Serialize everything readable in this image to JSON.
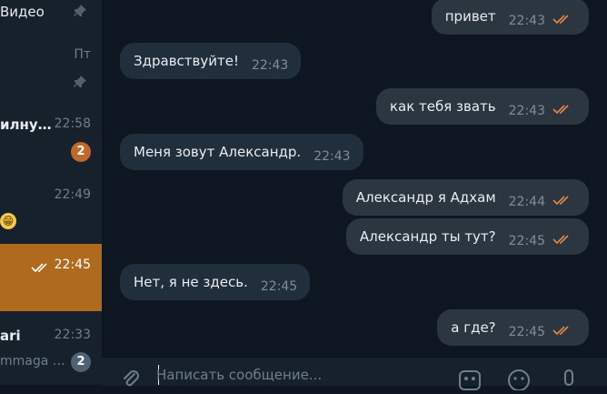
{
  "sidebar": {
    "chats": [
      {
        "name": "Видео",
        "time": "",
        "pinned": true,
        "badge": "",
        "preview": ""
      },
      {
        "name": "",
        "time": "Пт",
        "pinned": true,
        "badge": "",
        "preview": ""
      },
      {
        "name": "илну…",
        "time": "22:58",
        "pinned": false,
        "badge": "2",
        "badge_color": "#c0692b",
        "preview": ""
      },
      {
        "name": "",
        "time": "22:49",
        "pinned": false,
        "badge": "",
        "preview": "",
        "emoji": "😁"
      },
      {
        "name": "",
        "time": "22:45",
        "pinned": false,
        "badge": "",
        "preview": "",
        "active": true,
        "read_ticks": true
      },
      {
        "name": "ari",
        "time": "22:33",
        "pinned": false,
        "badge": "2",
        "badge_color": "#4f6173",
        "preview": "mmaga …"
      }
    ]
  },
  "messages": [
    {
      "direction": "out",
      "text": "привет",
      "time": "22:43",
      "read": true
    },
    {
      "direction": "in",
      "text": "Здравствуйте!",
      "time": "22:43"
    },
    {
      "direction": "out",
      "text": "как тебя звать",
      "time": "22:43",
      "read": true
    },
    {
      "direction": "in",
      "text": "Меня зовут Александр.",
      "time": "22:43"
    },
    {
      "direction": "out",
      "text": "Александр я Адхам",
      "time": "22:44",
      "read": true
    },
    {
      "direction": "out",
      "text": "Александр ты тут?",
      "time": "22:45",
      "read": true
    },
    {
      "direction": "in",
      "text": "Нет, я не здесь.",
      "time": "22:45"
    },
    {
      "direction": "out",
      "text": "а где?",
      "time": "22:45",
      "read": true
    }
  ],
  "composer": {
    "placeholder": "Написать сообщение...",
    "value": "",
    "icons": [
      "attach-icon",
      "bot-commands-icon",
      "emoji-icon",
      "microphone-icon"
    ]
  },
  "colors": {
    "chat_bg": "#0e1621",
    "sidebar_bg": "#17212b",
    "active_chat": "#b06a1e",
    "bubble_in": "#212e3b",
    "bubble_out": "#2b3640",
    "read_ticks": "#e0884a",
    "unread_badge": "#c0692b"
  }
}
